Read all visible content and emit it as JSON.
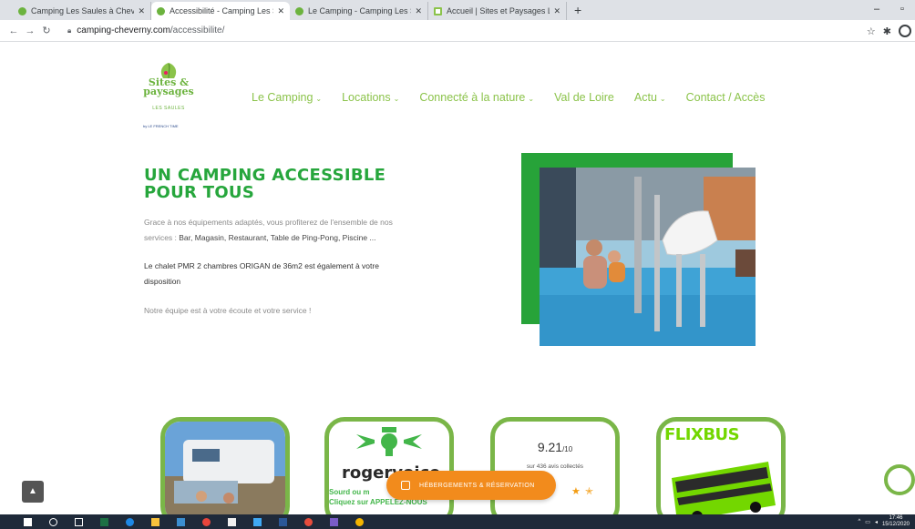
{
  "browser": {
    "tabs": [
      {
        "title": "Camping Les Saules à Cheverny",
        "active": false
      },
      {
        "title": "Accessibilité - Camping Les Saules",
        "active": true
      },
      {
        "title": "Le Camping - Camping Les Saules",
        "active": false
      },
      {
        "title": "Accueil | Sites et Paysages Les Sa",
        "active": false
      }
    ],
    "url_host": "camping-cheverny.com",
    "url_path": "/accessibilite/"
  },
  "site": {
    "logo_line1": "Sites &",
    "logo_line2": "paysages",
    "logo_sub": "LES SAULES",
    "logo_french": "by LE FRENCH TIME",
    "menu": [
      {
        "label": "Le Camping",
        "has_dropdown": true
      },
      {
        "label": "Locations",
        "has_dropdown": true
      },
      {
        "label": "Connecté à la nature",
        "has_dropdown": true
      },
      {
        "label": "Val de Loire",
        "has_dropdown": false
      },
      {
        "label": "Actu",
        "has_dropdown": true
      },
      {
        "label": "Contact / Accès",
        "has_dropdown": false
      }
    ]
  },
  "hero": {
    "title_line1": "UN CAMPING ACCESSIBLE",
    "title_line2": "POUR TOUS",
    "p1_line1": "Grace à nos équipements adaptés, vous profiterez de l'ensemble de nos",
    "p1_line2_prefix": "services : ",
    "p1_line2_bold": "Bar, Magasin, Restaurant, Table de Ping-Pong, Piscine ...",
    "p2_line1": "Le chalet PMR 2 chambres ORIGAN de 36m2 est également à votre",
    "p2_line2": "disposition",
    "p3": "Notre équipe est à votre écoute et votre service !"
  },
  "cards": {
    "rogervoice_name": "rogervoice",
    "rogervoice_line1": "Sourd ou m",
    "rogervoice_line2": "Cliquez sur APPELEZ-NOUS",
    "score": "9.21",
    "score_max": "/10",
    "score_sub": "sur 436 avis collectés",
    "flixbus": "FLIXBUS"
  },
  "actions": {
    "reservation": "HÉBERGEMENTS & RÉSERVATION"
  },
  "taskbar": {
    "time": "17:46",
    "date": "15/12/2020"
  },
  "colors": {
    "brand_green": "#6cb33e",
    "title_green": "#26a63c",
    "card_border": "#7ab648",
    "cta_orange": "#f28b1c"
  }
}
